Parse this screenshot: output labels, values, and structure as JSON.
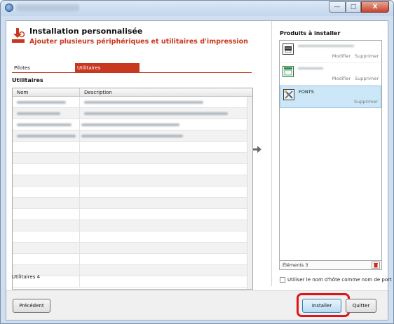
{
  "window": {
    "controls": {
      "minimize": "—",
      "maximize": "□",
      "close": "X"
    }
  },
  "header": {
    "title": "Installation personnalisée",
    "subtitle": "Ajouter plusieurs périphériques et utilitaires d'impression"
  },
  "tabs": [
    {
      "label": "Pilotes",
      "active": false
    },
    {
      "label": "Utilitaires",
      "active": true
    }
  ],
  "utilities": {
    "section_title": "Utilitaires",
    "columns": [
      "Nom",
      "Description"
    ],
    "footer": "Utilitaires 4"
  },
  "products": {
    "title": "Produits à installer",
    "items": [
      {
        "name": "",
        "actions": [
          "Modifier",
          "Supprimer"
        ],
        "icon": "printer-icon"
      },
      {
        "name": "",
        "actions": [
          "Modifier",
          "Supprimer"
        ],
        "icon": "window-icon"
      },
      {
        "name": "FONTS",
        "actions": [
          "Supprimer"
        ],
        "icon": "tools-icon"
      }
    ],
    "count_label": "Éléments 3"
  },
  "options": {
    "use_hostname_label": "Utiliser le nom d'hôte comme nom de port",
    "use_hostname_checked": false
  },
  "buttons": {
    "previous": "Précédent",
    "install": "Installer",
    "quit": "Quitter"
  },
  "colors": {
    "accent": "#c8381f",
    "highlight": "#e0141b",
    "selection": "#cce8f8"
  }
}
